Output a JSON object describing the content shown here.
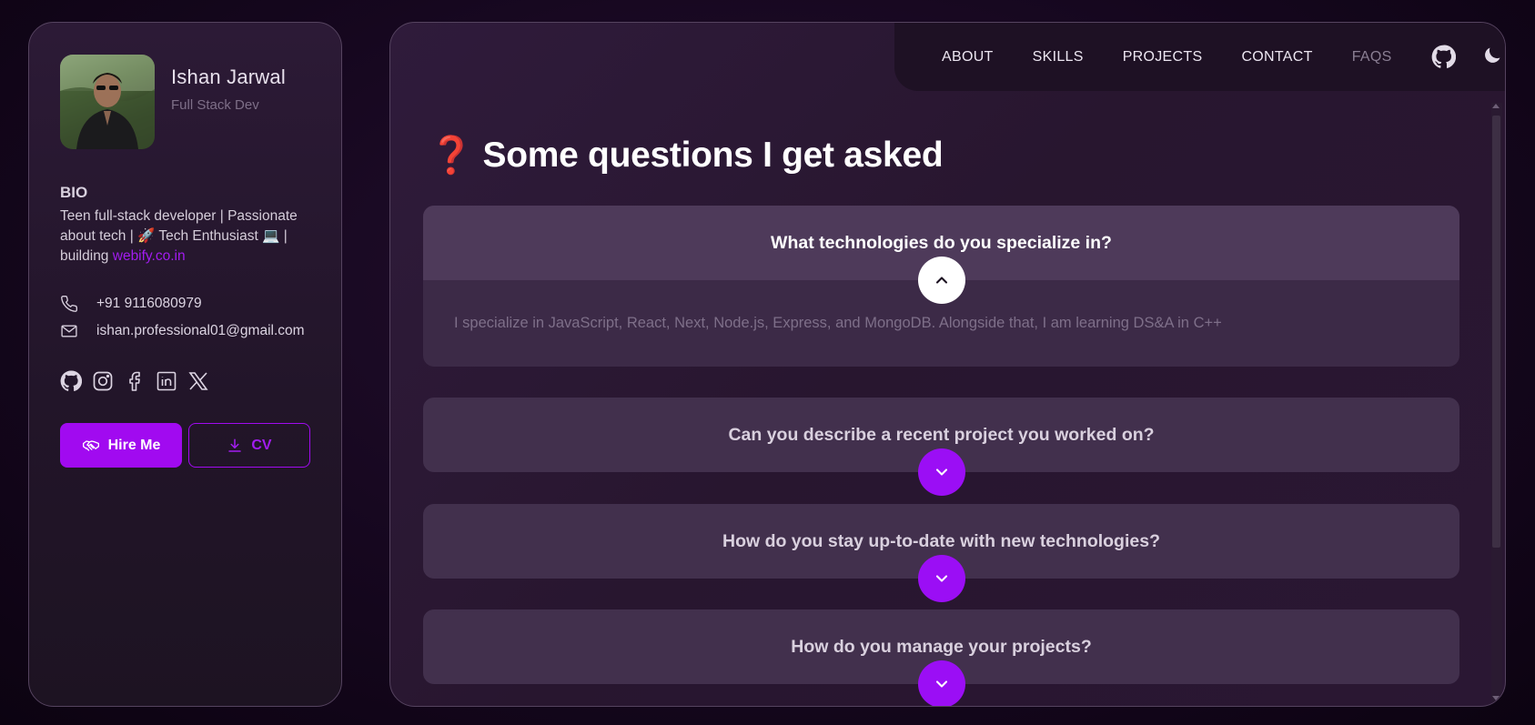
{
  "profile": {
    "name": "Ishan Jarwal",
    "role": "Full Stack Dev"
  },
  "bio": {
    "title": "BIO",
    "text_before_link": "Teen full-stack developer | Passionate about tech | 🚀 Tech Enthusiast 💻 | building ",
    "link_text": "webify.co.in"
  },
  "contact": {
    "phone": "+91 9116080979",
    "email": "ishan.professional01@gmail.com"
  },
  "socials": [
    {
      "icon": "github-icon"
    },
    {
      "icon": "instagram-icon"
    },
    {
      "icon": "facebook-icon"
    },
    {
      "icon": "linkedin-icon"
    },
    {
      "icon": "x-twitter-icon"
    }
  ],
  "buttons": {
    "hire": "Hire Me",
    "cv": "CV"
  },
  "nav": {
    "items": [
      "ABOUT",
      "SKILLS",
      "PROJECTS",
      "CONTACT",
      "FAQS"
    ],
    "active": "FAQS"
  },
  "faq": {
    "heading_emoji": "❓",
    "heading": "Some questions I get asked",
    "items": [
      {
        "question": "What technologies do you specialize in?",
        "answer": "I specialize in JavaScript, React, Next, Node.js, Express, and MongoDB. Alongside that, I am learning DS&A in C++",
        "open": true
      },
      {
        "question": "Can you describe a recent project you worked on?",
        "open": false
      },
      {
        "question": "How do you stay up-to-date with new technologies?",
        "open": false
      },
      {
        "question": "How do you manage your projects?",
        "open": false
      }
    ]
  },
  "colors": {
    "accent": "#a10af0",
    "background": "#16071f",
    "panel": "#2f1b3b"
  }
}
